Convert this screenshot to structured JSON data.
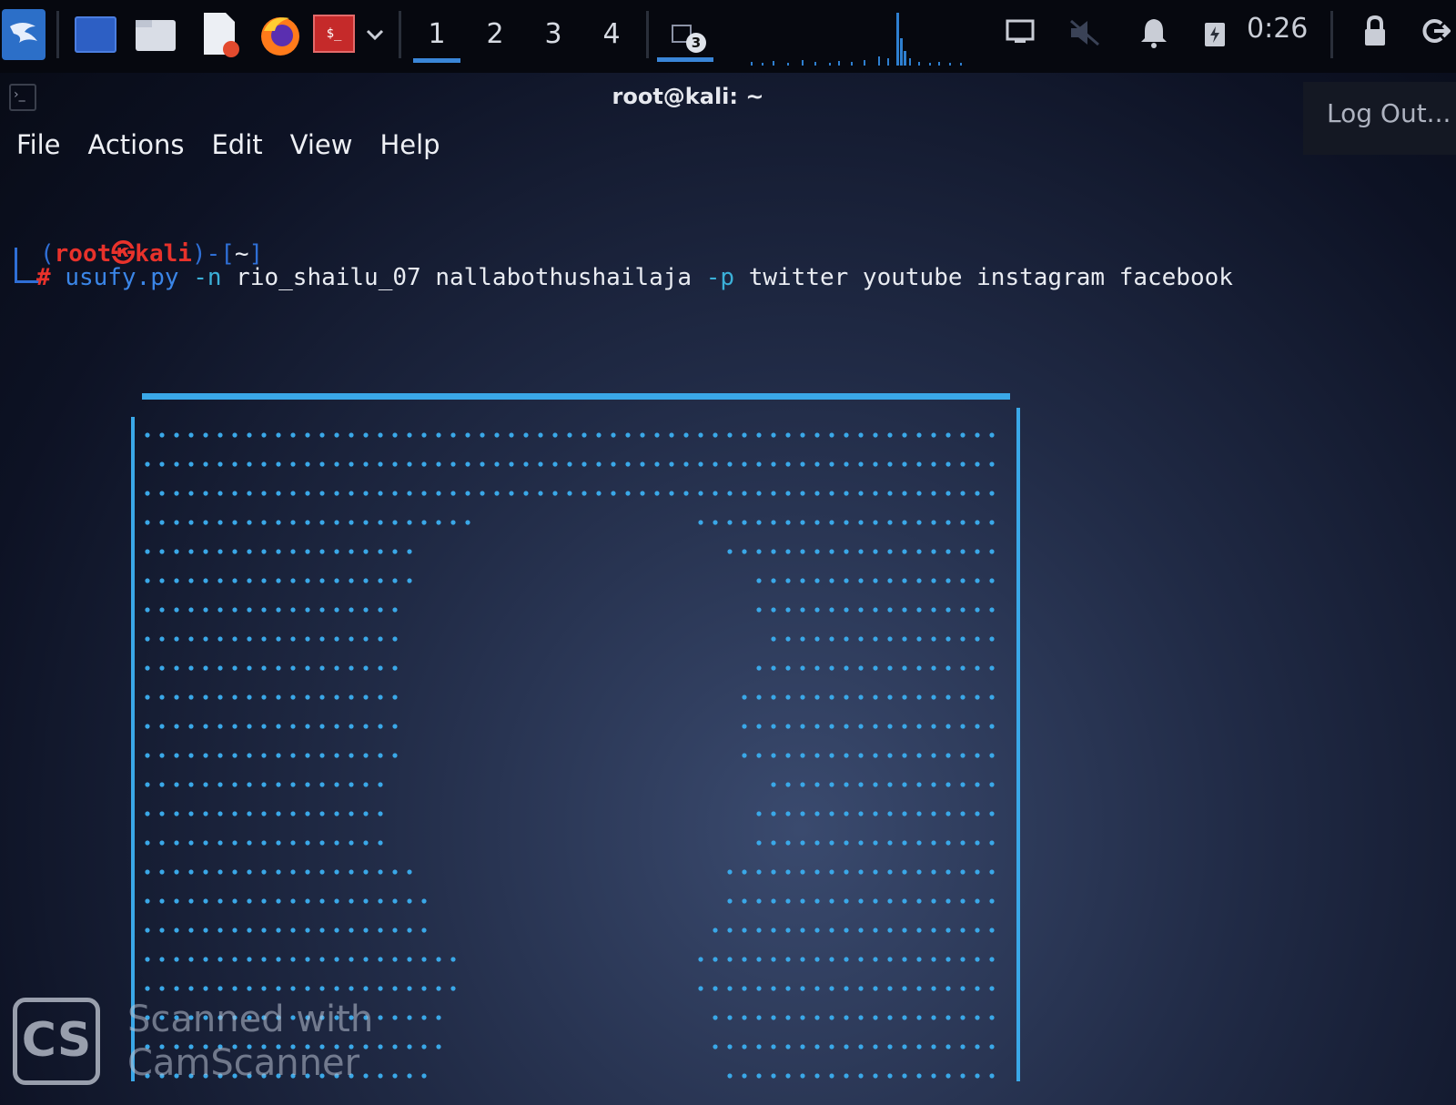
{
  "taskbar": {
    "launchers": [
      "kali-dragon-icon",
      "desktop-icon",
      "file-manager-icon",
      "text-editor-icon",
      "firefox-icon",
      "terminal-icon",
      "chevron-down-icon"
    ],
    "workspaces": [
      "1",
      "2",
      "3",
      "4"
    ],
    "active_workspace": "1",
    "window_badge": "3",
    "clock": "0:26"
  },
  "window": {
    "title": "root@kali: ~",
    "logout_label": "Log Out..."
  },
  "menu": {
    "file": "File",
    "actions": "Actions",
    "edit": "Edit",
    "view": "View",
    "help": "Help"
  },
  "terminal": {
    "prompt_open": "(",
    "user": "root",
    "at": "㉿",
    "host": "kali",
    "prompt_close": ")-[",
    "cwd": "~",
    "prompt_end": "]",
    "hash": "#",
    "command": "usufy.py",
    "flag_n": "-n",
    "names": "rio_shailu_07 nallabothushailaja",
    "flag_p": "-p",
    "platforms": "twitter youtube instagram facebook"
  },
  "watermark": {
    "logo": "CS",
    "line1": "Scanned with",
    "line2": "CamScanner"
  },
  "colors": {
    "accent_blue": "#3a86d8",
    "prompt_red": "#e8322b",
    "art_dots": "#3aa8e8"
  }
}
